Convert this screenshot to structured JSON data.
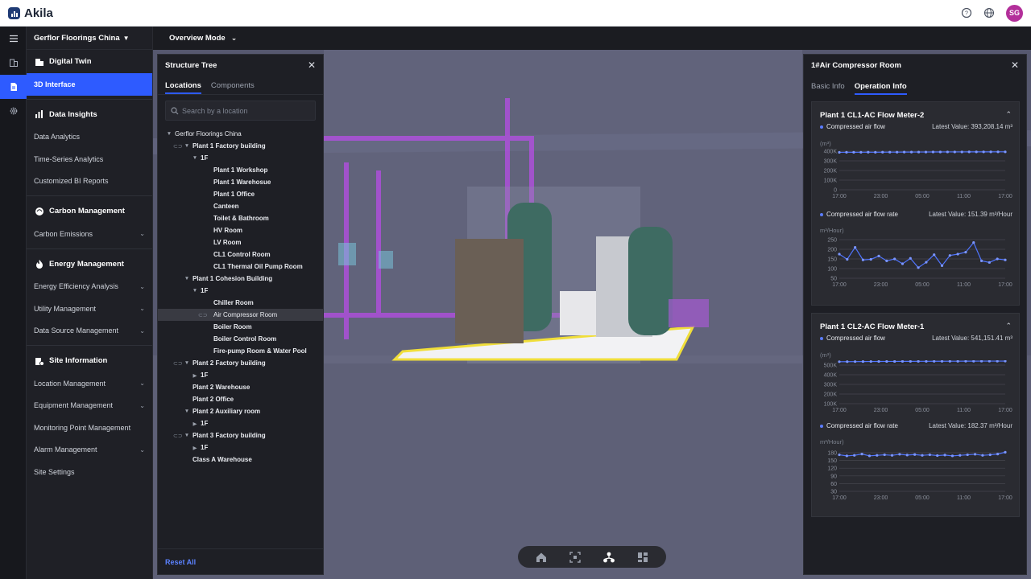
{
  "app": {
    "name": "Akila",
    "user_initials": "SG"
  },
  "sidebar": {
    "project": "Gerflor Floorings China",
    "sections": [
      {
        "title": "Digital Twin",
        "icon": "building-icon",
        "items": [
          {
            "label": "3D Interface",
            "active": true,
            "expand": false
          }
        ]
      },
      {
        "title": "Data Insights",
        "icon": "bar-chart-icon",
        "items": [
          {
            "label": "Data Analytics",
            "expand": false
          },
          {
            "label": "Time-Series Analytics",
            "expand": false
          },
          {
            "label": "Customized BI Reports",
            "expand": false
          }
        ]
      },
      {
        "title": "Carbon Management",
        "icon": "globe-leaf-icon",
        "items": [
          {
            "label": "Carbon Emissions",
            "expand": true
          }
        ]
      },
      {
        "title": "Energy Management",
        "icon": "flame-icon",
        "items": [
          {
            "label": "Energy Efficiency Analysis",
            "expand": true
          },
          {
            "label": "Utility Management",
            "expand": true
          },
          {
            "label": "Data Source Management",
            "expand": true
          }
        ]
      },
      {
        "title": "Site Information",
        "icon": "site-icon",
        "items": [
          {
            "label": "Location Management",
            "expand": true
          },
          {
            "label": "Equipment Management",
            "expand": true
          },
          {
            "label": "Monitoring Point Management",
            "expand": false
          },
          {
            "label": "Alarm Management",
            "expand": true
          },
          {
            "label": "Site Settings",
            "expand": false
          }
        ]
      }
    ]
  },
  "modebar": {
    "label": "Overview Mode"
  },
  "structure_tree": {
    "title": "Structure Tree",
    "tabs": [
      "Locations",
      "Components"
    ],
    "active_tab": 0,
    "search_placeholder": "Search by a location",
    "reset_label": "Reset All",
    "nodes": [
      {
        "label": "Gerflor Floorings China",
        "depth": 0,
        "toggle": "down",
        "link": false,
        "bold": false
      },
      {
        "label": "Plant 1 Factory building",
        "depth": 1,
        "toggle": "down",
        "link": true,
        "bold": true
      },
      {
        "label": "1F",
        "depth": 2,
        "toggle": "down",
        "link": false,
        "bold": true
      },
      {
        "label": "Plant 1 Workshop",
        "depth": 3,
        "toggle": "",
        "link": false,
        "bold": true
      },
      {
        "label": "Plant 1 Warehosue",
        "depth": 3,
        "toggle": "",
        "link": false,
        "bold": true
      },
      {
        "label": "Plant 1 Office",
        "depth": 3,
        "toggle": "",
        "link": false,
        "bold": true
      },
      {
        "label": "Canteen",
        "depth": 3,
        "toggle": "",
        "link": false,
        "bold": true
      },
      {
        "label": "Toilet & Bathroom",
        "depth": 3,
        "toggle": "",
        "link": false,
        "bold": true
      },
      {
        "label": "HV Room",
        "depth": 3,
        "toggle": "",
        "link": false,
        "bold": true
      },
      {
        "label": "LV Room",
        "depth": 3,
        "toggle": "",
        "link": false,
        "bold": true
      },
      {
        "label": "CL1 Control Room",
        "depth": 3,
        "toggle": "",
        "link": false,
        "bold": true
      },
      {
        "label": "CL1 Thermal Oil Pump Room",
        "depth": 3,
        "toggle": "",
        "link": false,
        "bold": true
      },
      {
        "label": "Plant 1 Cohesion Building",
        "depth": 1,
        "toggle": "down",
        "link": false,
        "bold": true
      },
      {
        "label": "1F",
        "depth": 2,
        "toggle": "down",
        "link": false,
        "bold": true
      },
      {
        "label": "Chiller Room",
        "depth": 3,
        "toggle": "",
        "link": false,
        "bold": true
      },
      {
        "label": "Air Compressor Room",
        "depth": 3,
        "toggle": "",
        "link": true,
        "bold": false,
        "selected": true
      },
      {
        "label": "Boiler Room",
        "depth": 3,
        "toggle": "",
        "link": false,
        "bold": true
      },
      {
        "label": "Boiler Control Room",
        "depth": 3,
        "toggle": "",
        "link": false,
        "bold": true
      },
      {
        "label": "Fire-pump Room & Water Pool",
        "depth": 3,
        "toggle": "",
        "link": false,
        "bold": true
      },
      {
        "label": "Plant 2 Factory building",
        "depth": 1,
        "toggle": "down",
        "link": true,
        "bold": true
      },
      {
        "label": "1F",
        "depth": 2,
        "toggle": "right",
        "link": false,
        "bold": true
      },
      {
        "label": "Plant 2 Warehouse",
        "depth": 1,
        "toggle": "",
        "link": false,
        "bold": true
      },
      {
        "label": "Plant 2 Office",
        "depth": 1,
        "toggle": "",
        "link": false,
        "bold": true
      },
      {
        "label": "Plant 2 Auxiliary room",
        "depth": 1,
        "toggle": "down",
        "link": false,
        "bold": true
      },
      {
        "label": "1F",
        "depth": 2,
        "toggle": "right",
        "link": false,
        "bold": true
      },
      {
        "label": "Plant 3 Factory building",
        "depth": 1,
        "toggle": "down",
        "link": true,
        "bold": true
      },
      {
        "label": "1F",
        "depth": 2,
        "toggle": "right",
        "link": false,
        "bold": true
      },
      {
        "label": "Class A Warehouse",
        "depth": 1,
        "toggle": "",
        "link": false,
        "bold": true
      }
    ]
  },
  "info_panel": {
    "title": "1#Air Compressor Room",
    "tabs": [
      "Basic Info",
      "Operation Info"
    ],
    "active_tab": 1
  },
  "chart_data": [
    {
      "type": "line",
      "title": "Plant 1 CL1-AC Flow Meter-2",
      "series_name": "Compressed air flow",
      "latest": "Latest Value: 393,208.14 m³",
      "unit": "(m³)",
      "ylim": [
        0,
        400000
      ],
      "yticks": [
        "400K",
        "300K",
        "200K",
        "100K",
        "0"
      ],
      "ytick_values": [
        400000,
        300000,
        200000,
        100000,
        0
      ],
      "xticks": [
        "17:00",
        "23:00",
        "05:00",
        "11:00",
        "17:00"
      ],
      "values": [
        388000,
        389000,
        388500,
        389000,
        389500,
        389000,
        389500,
        390000,
        390000,
        390500,
        390500,
        391000,
        391000,
        391500,
        391500,
        392000,
        392000,
        392000,
        392500,
        392500,
        393000,
        393000,
        393200,
        393208
      ]
    },
    {
      "type": "line",
      "title": "",
      "series_name": "Compressed air flow rate",
      "latest": "Latest Value: 151.39 m³/Hour",
      "unit": "m³/Hour)",
      "ylim": [
        50,
        250
      ],
      "yticks": [
        "250",
        "200",
        "150",
        "100",
        "50"
      ],
      "ytick_values": [
        250,
        200,
        150,
        100,
        50
      ],
      "xticks": [
        "17:00",
        "23:00",
        "05:00",
        "11:00",
        "17:00"
      ],
      "values": [
        175,
        148,
        210,
        145,
        148,
        165,
        140,
        150,
        125,
        153,
        105,
        133,
        172,
        115,
        168,
        175,
        185,
        235,
        140,
        132,
        150,
        145
      ]
    },
    {
      "type": "line",
      "title": "Plant 1 CL2-AC Flow Meter-1",
      "series_name": "Compressed air flow",
      "latest": "Latest Value: 541,151.41 m³",
      "unit": "(m³)",
      "ylim": [
        100000,
        500000
      ],
      "yticks": [
        "500K",
        "400K",
        "300K",
        "200K",
        "100K"
      ],
      "ytick_values": [
        500000,
        400000,
        300000,
        200000,
        100000
      ],
      "xticks": [
        "17:00",
        "23:00",
        "05:00",
        "11:00",
        "17:00"
      ],
      "values": [
        535000,
        535500,
        536000,
        536500,
        537000,
        537500,
        538000,
        538000,
        538500,
        538500,
        539000,
        539000,
        539500,
        539500,
        540000,
        540000,
        540500,
        540500,
        541000,
        541000,
        541100,
        541151
      ]
    },
    {
      "type": "line",
      "title": "",
      "series_name": "Compressed air flow rate",
      "latest": "Latest Value: 182.37 m³/Hour",
      "unit": "m³/Hour)",
      "ylim": [
        30,
        180
      ],
      "yticks": [
        "180",
        "150",
        "120",
        "90",
        "60",
        "30"
      ],
      "ytick_values": [
        180,
        150,
        120,
        90,
        60,
        30
      ],
      "xticks": [
        "17:00",
        "23:00",
        "05:00",
        "11:00",
        "17:00"
      ],
      "values": [
        172,
        168,
        170,
        175,
        168,
        170,
        172,
        170,
        174,
        171,
        173,
        170,
        172,
        169,
        171,
        168,
        170,
        172,
        174,
        170,
        172,
        175,
        182
      ]
    }
  ]
}
